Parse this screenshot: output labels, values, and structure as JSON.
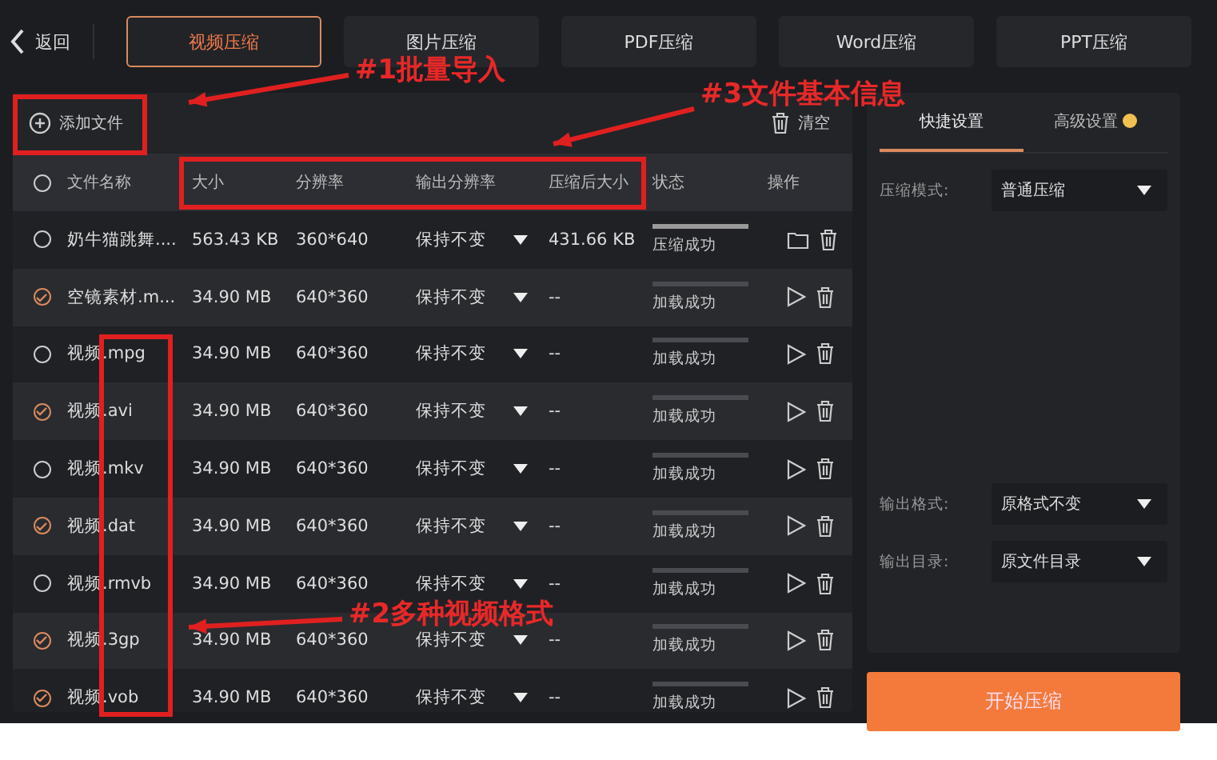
{
  "top_bar": {
    "back": "返回",
    "tabs": [
      {
        "label": "视频压缩",
        "selected": true
      },
      {
        "label": "图片压缩",
        "selected": false
      },
      {
        "label": "PDF压缩",
        "selected": false
      },
      {
        "label": "Word压缩",
        "selected": false
      },
      {
        "label": "PPT压缩",
        "selected": false
      }
    ]
  },
  "file_panel": {
    "add_button": "添加文件",
    "clear_button": "清空",
    "select_all": {
      "checked": false
    },
    "columns": [
      "文件名称",
      "大小",
      "分辨率",
      "输出分辨率",
      "压缩后大小",
      "状态",
      "操作"
    ],
    "rows": [
      {
        "checked": false,
        "name": "奶牛猫跳舞....",
        "size": "563.43 KB",
        "resolution": "360*640",
        "output_resolution": "保持不变",
        "compressed_size": "431.66 KB",
        "status": "压缩成功",
        "level": 1,
        "done": true
      },
      {
        "checked": true,
        "name": "空镜素材.m...",
        "size": "34.90 MB",
        "resolution": "640*360",
        "output_resolution": "保持不变",
        "compressed_size": "--",
        "status": "加载成功",
        "level": 1,
        "done": false
      },
      {
        "checked": false,
        "name": "视频.mpg",
        "size": "34.90 MB",
        "resolution": "640*360",
        "output_resolution": "保持不变",
        "compressed_size": "--",
        "status": "加载成功",
        "level": 1,
        "done": false
      },
      {
        "checked": true,
        "name": "视频.avi",
        "size": "34.90 MB",
        "resolution": "640*360",
        "output_resolution": "保持不变",
        "compressed_size": "--",
        "status": "加载成功",
        "level": 1,
        "done": false
      },
      {
        "checked": false,
        "name": "视频.mkv",
        "size": "34.90 MB",
        "resolution": "640*360",
        "output_resolution": "保持不变",
        "compressed_size": "--",
        "status": "加载成功",
        "level": 1,
        "done": false
      },
      {
        "checked": true,
        "name": "视频.dat",
        "size": "34.90 MB",
        "resolution": "640*360",
        "output_resolution": "保持不变",
        "compressed_size": "--",
        "status": "加载成功",
        "level": 1,
        "done": false
      },
      {
        "checked": false,
        "name": "视频.rmvb",
        "size": "34.90 MB",
        "resolution": "640*360",
        "output_resolution": "保持不变",
        "compressed_size": "--",
        "status": "加载成功",
        "level": 1,
        "done": false
      },
      {
        "checked": true,
        "name": "视频.3gp",
        "size": "34.90 MB",
        "resolution": "640*360",
        "output_resolution": "保持不变",
        "compressed_size": "--",
        "status": "加载成功",
        "level": 1,
        "done": false
      },
      {
        "checked": true,
        "name": "视频.vob",
        "size": "34.90 MB",
        "resolution": "640*360",
        "output_resolution": "保持不变",
        "compressed_size": "--",
        "status": "加载成功",
        "level": 1,
        "done": false
      }
    ]
  },
  "settings_panel": {
    "tabs": [
      {
        "label": "快捷设置",
        "selected": true
      },
      {
        "label": "高级设置",
        "selected": false
      }
    ],
    "fields": [
      {
        "label": "压缩模式:",
        "value": "普通压缩"
      },
      {
        "label": "输出格式:",
        "value": "原格式不变"
      },
      {
        "label": "输出目录:",
        "value": "原文件目录"
      }
    ],
    "start_button": "开始压缩"
  },
  "annotations": [
    {
      "text": "#1批量导入"
    },
    {
      "text": "#3文件基本信息"
    },
    {
      "text": "#2多种视频格式"
    }
  ]
}
